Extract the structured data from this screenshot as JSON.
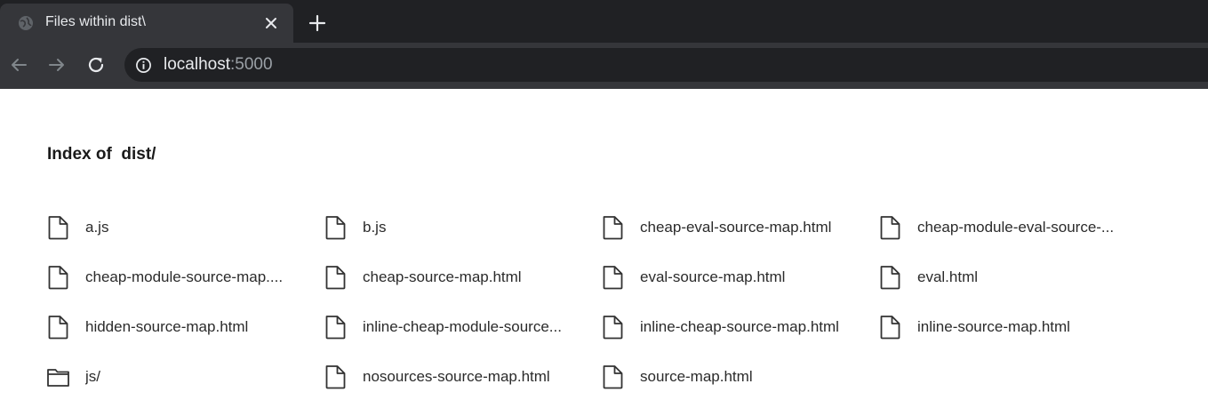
{
  "browser": {
    "tab_title": "Files within dist\\",
    "url_host": "localhost",
    "url_port": ":5000",
    "icons": {
      "favicon": "globe-icon",
      "close": "close-icon",
      "new_tab": "plus-icon",
      "back": "back-arrow-icon",
      "forward": "forward-arrow-icon",
      "reload": "reload-icon",
      "site_info": "info-icon"
    },
    "colors": {
      "tabstrip": "#202124",
      "active_tab": "#35363a",
      "text": "#e8eaed",
      "muted": "#9aa0a6"
    }
  },
  "page": {
    "heading": "Index of  dist/",
    "entries": [
      {
        "name": "a.js",
        "type": "file"
      },
      {
        "name": "b.js",
        "type": "file"
      },
      {
        "name": "cheap-eval-source-map.html",
        "type": "file"
      },
      {
        "name": "cheap-module-eval-source-...",
        "type": "file"
      },
      {
        "name": "cheap-module-source-map....",
        "type": "file"
      },
      {
        "name": "cheap-source-map.html",
        "type": "file"
      },
      {
        "name": "eval-source-map.html",
        "type": "file"
      },
      {
        "name": "eval.html",
        "type": "file"
      },
      {
        "name": "hidden-source-map.html",
        "type": "file"
      },
      {
        "name": "inline-cheap-module-source...",
        "type": "file"
      },
      {
        "name": "inline-cheap-source-map.html",
        "type": "file"
      },
      {
        "name": "inline-source-map.html",
        "type": "file"
      },
      {
        "name": "js/",
        "type": "folder"
      },
      {
        "name": "nosources-source-map.html",
        "type": "file"
      },
      {
        "name": "source-map.html",
        "type": "file"
      }
    ]
  }
}
